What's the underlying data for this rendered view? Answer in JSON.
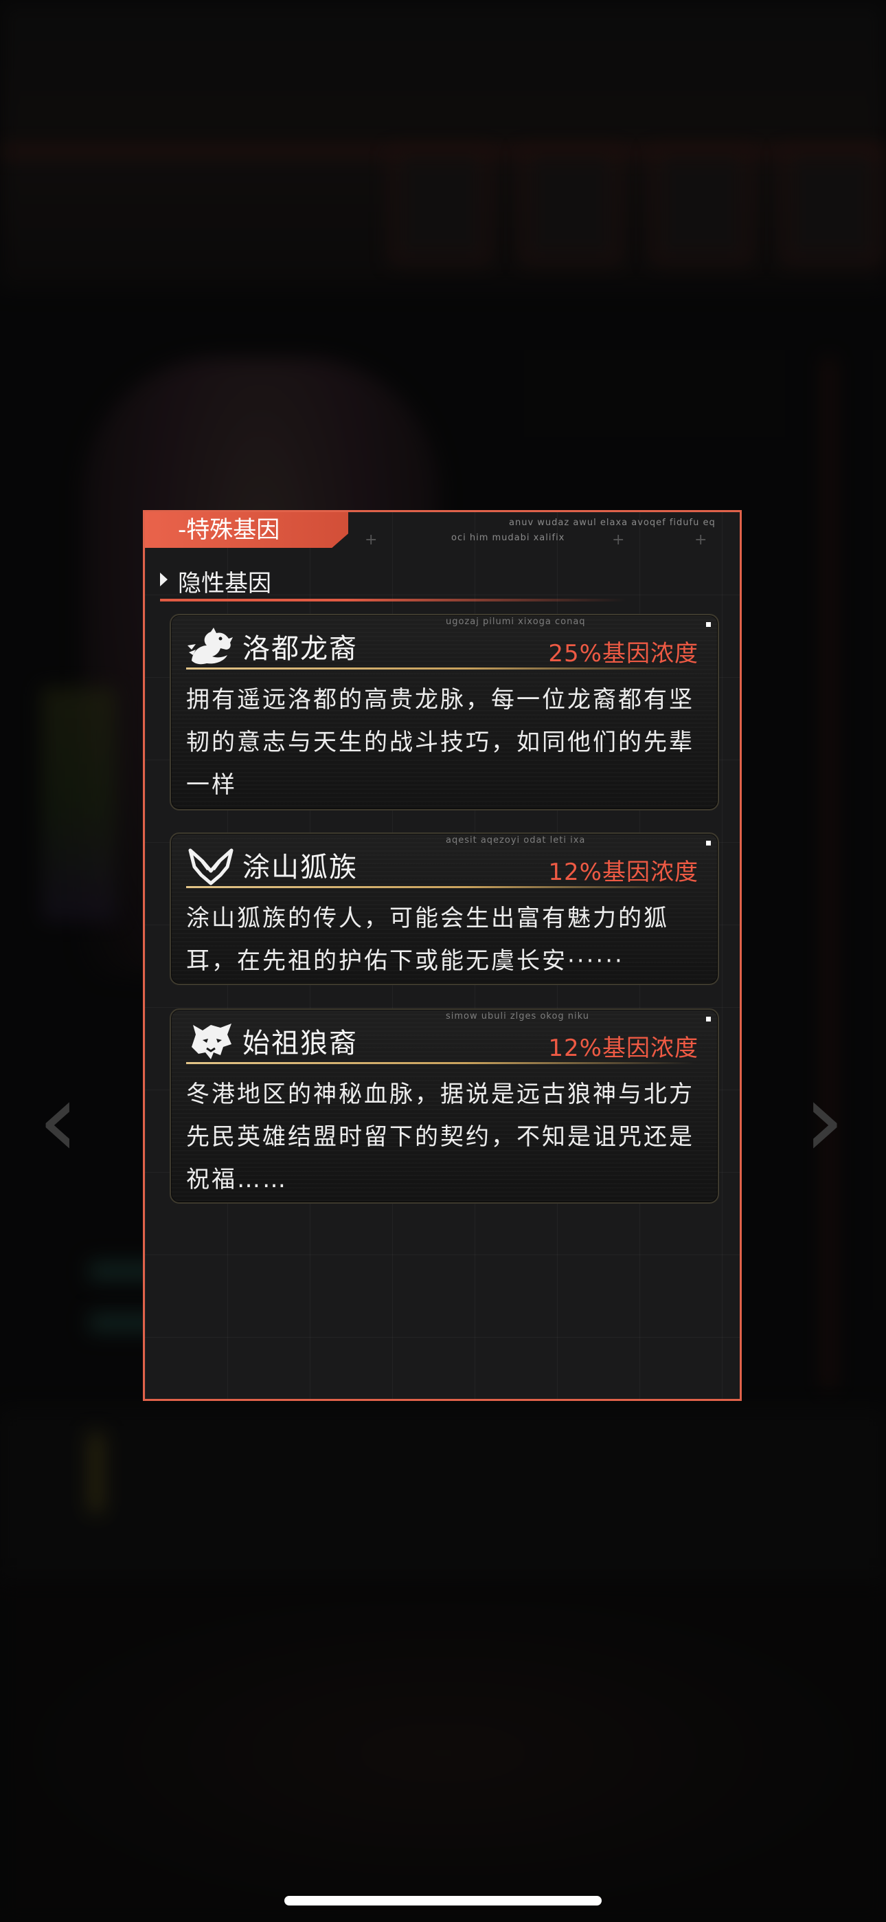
{
  "panel": {
    "tab_label": "-特殊基因",
    "tiny_header_1": "anuv wudaz awul elaxa avoqef fidufu eq",
    "tiny_header_2": "oci him mudabi xalifix",
    "section_label": "隐性基因"
  },
  "genes": [
    {
      "icon": "dragon-icon",
      "name": "洛都龙裔",
      "concentration": "25%基因浓度",
      "tiny_tag": "ugozaj pilumi xixoga conaq",
      "description": "拥有遥远洛都的高贵龙脉，每一位龙裔都有坚韧的意志与天生的战斗技巧，如同他们的先辈一样"
    },
    {
      "icon": "fox-icon",
      "name": "涂山狐族",
      "concentration": "12%基因浓度",
      "tiny_tag": "aqesit aqezoyi odat leti ixa",
      "description": "涂山狐族的传人，可能会生出富有魅力的狐耳，在先祖的护佑下或能无虞长安······"
    },
    {
      "icon": "wolf-icon",
      "name": "始祖狼裔",
      "concentration": "12%基因浓度",
      "tiny_tag": "simow ubuli zlges okog niku",
      "description": "冬港地区的神秘血脉，据说是远古狼神与北方先民英雄结盟时留下的契约，不知是诅咒还是祝福……"
    }
  ],
  "nav": {
    "left_arrow": "‹",
    "right_arrow": "›"
  },
  "colors": {
    "accent": "#e0624a",
    "concentration": "#ee5a44",
    "gold": "#c9a25d"
  }
}
